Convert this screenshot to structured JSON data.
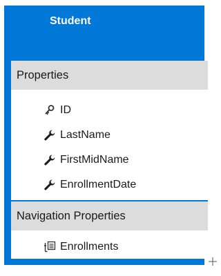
{
  "entity": {
    "title": "Student",
    "properties_header": "Properties",
    "properties": [
      {
        "name": "ID",
        "icon": "key-icon"
      },
      {
        "name": "LastName",
        "icon": "wrench-icon"
      },
      {
        "name": "FirstMidName",
        "icon": "wrench-icon"
      },
      {
        "name": "EnrollmentDate",
        "icon": "wrench-icon"
      }
    ],
    "navigation_header": "Navigation Properties",
    "navigation": [
      {
        "name": "Enrollments",
        "icon": "navigation-property-icon"
      }
    ]
  },
  "colors": {
    "accent": "#0078d7",
    "section_header_bg": "#dcdcdc",
    "text": "#1a1a1a"
  }
}
